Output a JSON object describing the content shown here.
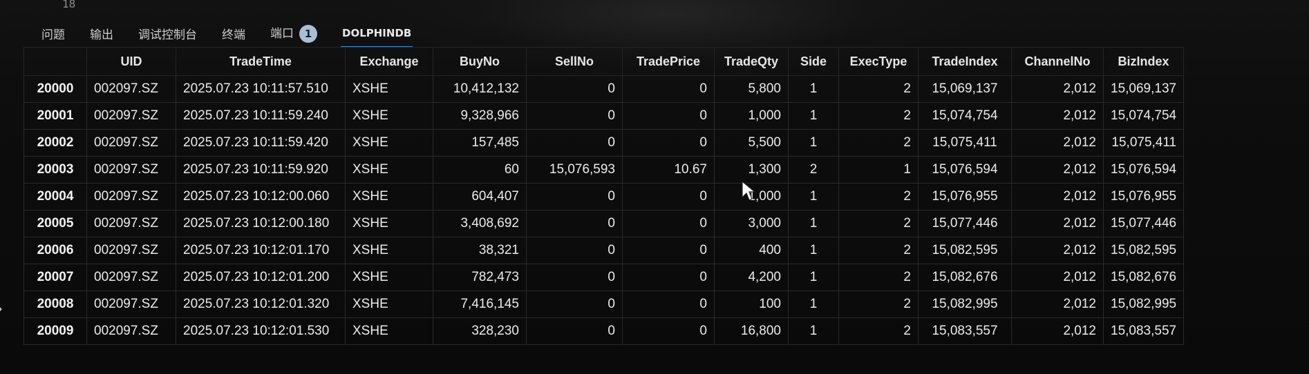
{
  "editor": {
    "line_number": "18"
  },
  "panel": {
    "tabs": [
      {
        "label": "问题"
      },
      {
        "label": "输出"
      },
      {
        "label": "调试控制台"
      },
      {
        "label": "终端"
      },
      {
        "label": "端口",
        "badge": "1"
      },
      {
        "label": "DOLPHINDB",
        "active": true
      }
    ]
  },
  "table": {
    "columns": [
      "",
      "UID",
      "TradeTime",
      "Exchange",
      "BuyNo",
      "SellNo",
      "TradePrice",
      "TradeQty",
      "Side",
      "ExecType",
      "TradeIndex",
      "ChannelNo",
      "BizIndex"
    ],
    "rows": [
      [
        "20000",
        "002097.SZ",
        "2025.07.23 10:11:57.510",
        "XSHE",
        "10,412,132",
        "0",
        "0",
        "5,800",
        "1",
        "2",
        "15,069,137",
        "2,012",
        "15,069,137"
      ],
      [
        "20001",
        "002097.SZ",
        "2025.07.23 10:11:59.240",
        "XSHE",
        "9,328,966",
        "0",
        "0",
        "1,000",
        "1",
        "2",
        "15,074,754",
        "2,012",
        "15,074,754"
      ],
      [
        "20002",
        "002097.SZ",
        "2025.07.23 10:11:59.420",
        "XSHE",
        "157,485",
        "0",
        "0",
        "5,500",
        "1",
        "2",
        "15,075,411",
        "2,012",
        "15,075,411"
      ],
      [
        "20003",
        "002097.SZ",
        "2025.07.23 10:11:59.920",
        "XSHE",
        "60",
        "15,076,593",
        "10.67",
        "1,300",
        "2",
        "1",
        "15,076,594",
        "2,012",
        "15,076,594"
      ],
      [
        "20004",
        "002097.SZ",
        "2025.07.23 10:12:00.060",
        "XSHE",
        "604,407",
        "0",
        "0",
        "1,000",
        "1",
        "2",
        "15,076,955",
        "2,012",
        "15,076,955"
      ],
      [
        "20005",
        "002097.SZ",
        "2025.07.23 10:12:00.180",
        "XSHE",
        "3,408,692",
        "0",
        "0",
        "3,000",
        "1",
        "2",
        "15,077,446",
        "2,012",
        "15,077,446"
      ],
      [
        "20006",
        "002097.SZ",
        "2025.07.23 10:12:01.170",
        "XSHE",
        "38,321",
        "0",
        "0",
        "400",
        "1",
        "2",
        "15,082,595",
        "2,012",
        "15,082,595"
      ],
      [
        "20007",
        "002097.SZ",
        "2025.07.23 10:12:01.200",
        "XSHE",
        "782,473",
        "0",
        "0",
        "4,200",
        "1",
        "2",
        "15,082,676",
        "2,012",
        "15,082,676"
      ],
      [
        "20008",
        "002097.SZ",
        "2025.07.23 10:12:01.320",
        "XSHE",
        "7,416,145",
        "0",
        "0",
        "100",
        "1",
        "2",
        "15,082,995",
        "2,012",
        "15,082,995"
      ],
      [
        "20009",
        "002097.SZ",
        "2025.07.23 10:12:01.530",
        "XSHE",
        "328,230",
        "0",
        "0",
        "16,800",
        "1",
        "2",
        "15,083,557",
        "2,012",
        "15,083,557"
      ]
    ]
  },
  "icons": {
    "pointer": "mouse-pointer-icon",
    "sidebar_toggle": "chevron-right-icon"
  },
  "colors": {
    "background": "#0c0c0c",
    "tab_active_underline": "#3d8fdc",
    "badge": "#a9bfd6"
  }
}
